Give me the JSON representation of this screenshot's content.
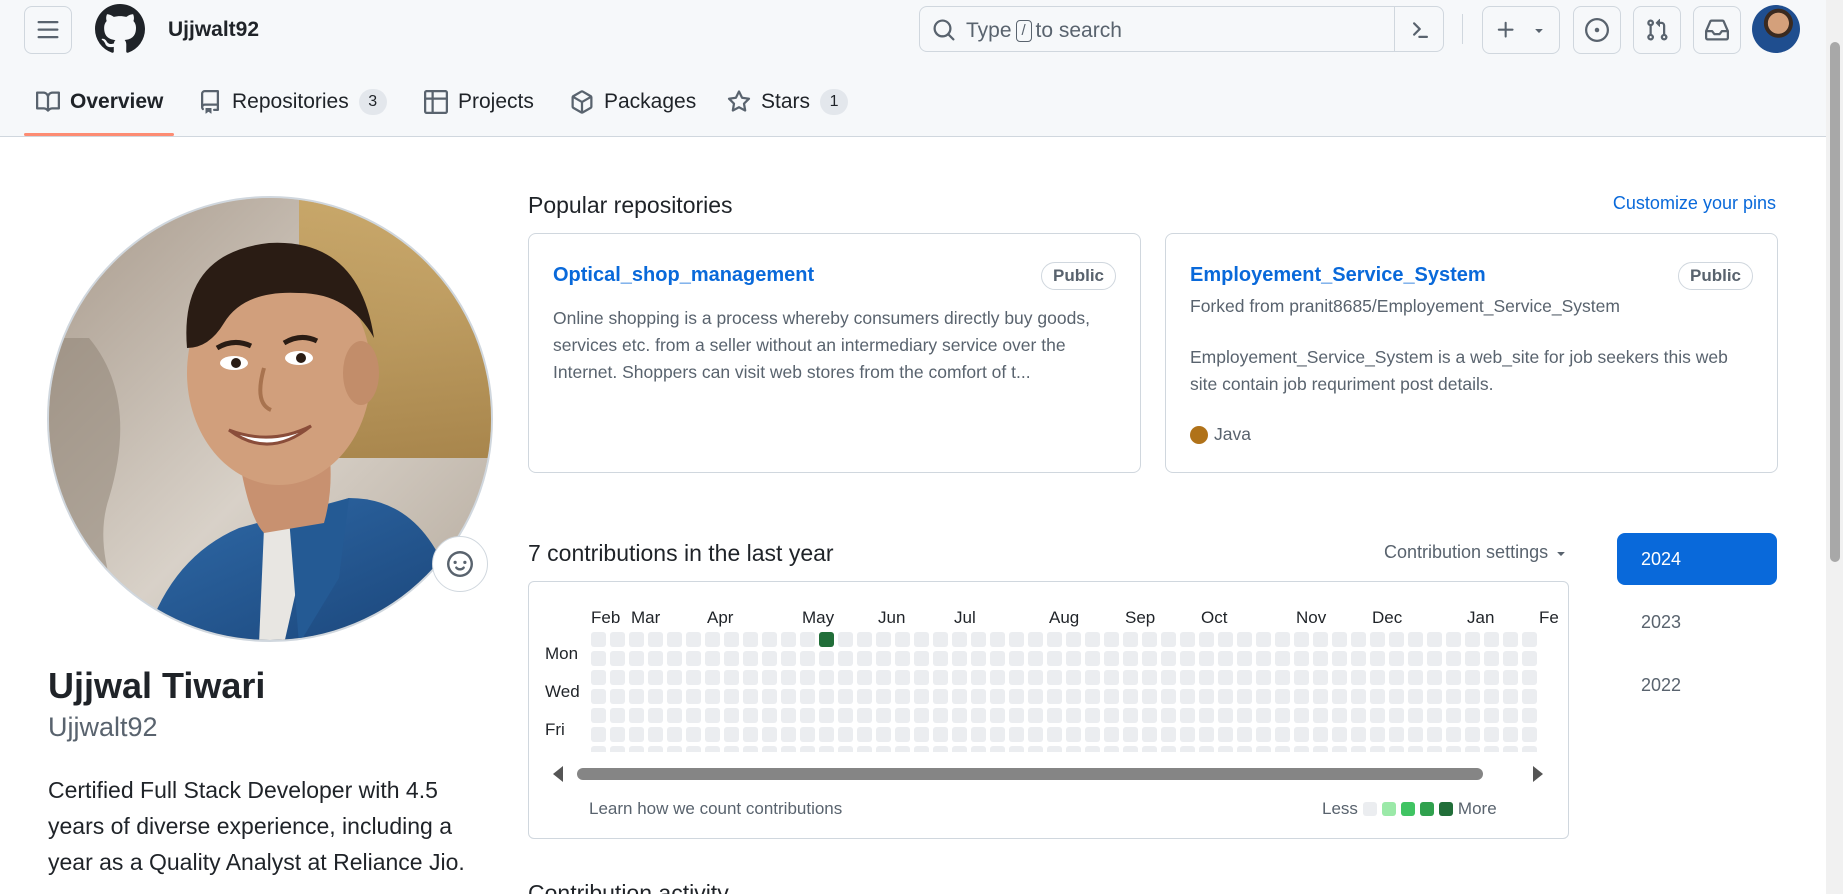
{
  "header": {
    "username": "Ujjwalt92",
    "search_prefix": "Type",
    "search_key": "/",
    "search_suffix": "to search"
  },
  "tabs": [
    {
      "label": "Overview",
      "icon": "book-icon"
    },
    {
      "label": "Repositories",
      "icon": "repo-icon",
      "count": "3"
    },
    {
      "label": "Projects",
      "icon": "table-icon"
    },
    {
      "label": "Packages",
      "icon": "package-icon"
    },
    {
      "label": "Stars",
      "icon": "star-icon",
      "count": "1"
    }
  ],
  "profile": {
    "full_name": "Ujjwal Tiwari",
    "login": "Ujjwalt92",
    "bio": "Certified Full Stack Developer with 4.5 years of diverse experience, including a year as a Quality Analyst at Reliance Jio."
  },
  "popular": {
    "title": "Popular repositories",
    "customize": "Customize your pins",
    "repos": [
      {
        "name": "Optical_shop_management",
        "visibility": "Public",
        "description": "Online shopping is a process whereby consumers directly buy goods, services etc. from a seller without an intermediary service over the Internet. Shoppers can visit web stores from the comfort of t..."
      },
      {
        "name": "Employement_Service_System",
        "visibility": "Public",
        "forked_prefix": "Forked from",
        "forked_from": "pranit8685/Employement_Service_System",
        "description": "Employement_Service_System is a web_site for job seekers this web site contain job requriment post details.",
        "language": "Java",
        "language_color": "#b07219"
      }
    ]
  },
  "contributions": {
    "title": "7 contributions in the last year",
    "settings": "Contribution settings",
    "months": [
      "Feb",
      "Mar",
      "Apr",
      "May",
      "Jun",
      "Jul",
      "Aug",
      "Sep",
      "Oct",
      "Nov",
      "Dec",
      "Jan",
      "Fe"
    ],
    "days": [
      "Mon",
      "Wed",
      "Fri"
    ],
    "learn": "Learn how we count contributions",
    "less": "Less",
    "more": "More",
    "active_cell": {
      "week": 12,
      "day": 0,
      "level": 4
    },
    "level_colors": [
      "#ebedf0",
      "#9be9a8",
      "#40c463",
      "#30a14e",
      "#216e39"
    ],
    "years": [
      "2024",
      "2023",
      "2022"
    ],
    "selected_year": "2024"
  },
  "next_section": "Contribution activity"
}
